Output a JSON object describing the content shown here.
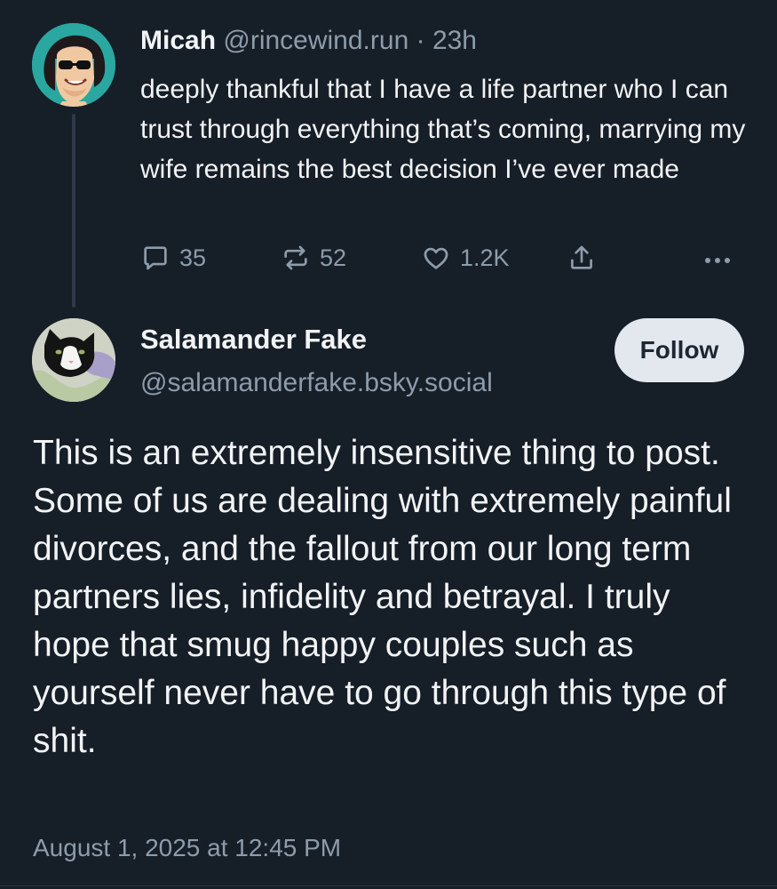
{
  "parent_post": {
    "author_name": "Micah",
    "handle": "@rincewind.run",
    "separator": "·",
    "age": "23h",
    "text": "deeply thankful that I have a life partner who I can trust through everything that’s coming, marrying my wife remains the best decision I’ve ever made",
    "reply_count": "35",
    "repost_count": "52",
    "like_count": "1.2K",
    "avatar_icon": "cartoon-man-sunglasses-avatar"
  },
  "reply_post": {
    "author_name": "Salamander Fake",
    "handle": "@salamanderfake.bsky.social",
    "follow_label": "Follow",
    "text": "This is an extremely insensitive thing to post. Some of us are dealing with extremely painful divorces, and the fallout from our long term partners lies, infidelity and betrayal. I truly hope that smug happy couples such as yourself never have to go through this type of shit.",
    "timestamp": "August 1, 2025 at 12:45 PM",
    "avatar_icon": "black-white-cat-avatar"
  },
  "icons": {
    "reply": "speech-bubble-icon",
    "repost": "repost-arrows-icon",
    "like": "heart-icon",
    "share": "share-upload-icon",
    "more": "ellipsis-icon"
  },
  "colors": {
    "background": "#161e27",
    "text": "#f1f3f5",
    "muted": "#8d9cab",
    "follow_button": "#e3e8ee",
    "thread_line": "#2e3a48"
  }
}
